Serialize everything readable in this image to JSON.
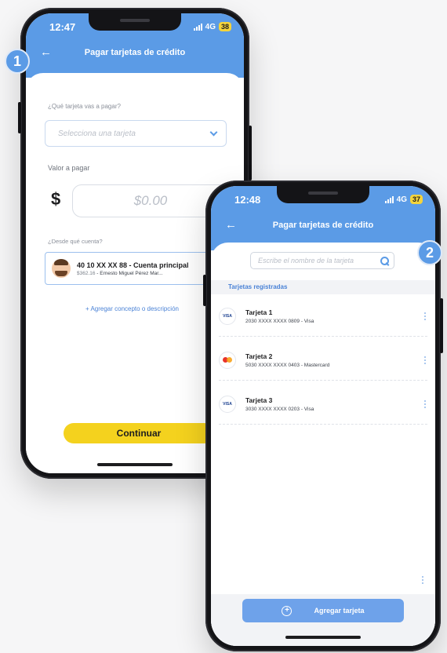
{
  "steps": {
    "step1": "1",
    "step2": "2"
  },
  "phone1": {
    "status": {
      "time": "12:47",
      "network": "4G",
      "battery": "38"
    },
    "header": {
      "title": "Pagar tarjetas de crédito"
    },
    "form": {
      "card_question": "¿Qué tarjeta vas a pagar?",
      "card_select_placeholder": "Selecciona una tarjeta",
      "amount_label": "Valor a pagar",
      "currency_symbol": "$",
      "amount_placeholder": "$0.00",
      "account_question": "¿Desde qué cuenta?",
      "account": {
        "title": "40 10 XX XX 88  - Cuenta principal",
        "balance": "$362.16",
        "holder": " - Ernesto Miguel Pérez Mar..."
      },
      "add_concept": "+ Agregar concepto o descripción",
      "continue_label": "Continuar"
    }
  },
  "phone2": {
    "status": {
      "time": "12:48",
      "network": "4G",
      "battery": "37"
    },
    "header": {
      "title": "Pagar tarjetas de crédito"
    },
    "search_placeholder": "Escribe el nombre de la tarjeta",
    "section_title": "Tarjetas registradas",
    "cards": [
      {
        "name": "Tarjeta 1",
        "number": "2030 XXXX XXXX 0809 - Visa",
        "brand": "visa",
        "logo_text": "VISA"
      },
      {
        "name": "Tarjeta 2",
        "number": "5030 XXXX XXXX 0403 - Mastercard",
        "brand": "mastercard",
        "logo_text": ""
      },
      {
        "name": "Tarjeta 3",
        "number": "3030 XXXX XXXX 0203 - Visa",
        "brand": "visa",
        "logo_text": "VISA"
      }
    ],
    "add_card_label": "Agregar tarjeta"
  },
  "colors": {
    "header_blue": "#5b9be6",
    "continue_yellow": "#f4d21e",
    "add_button_blue": "#6ea2ea",
    "battery_yellow": "#f4d43c"
  },
  "icons": [
    "back-arrow-icon",
    "signal-icon",
    "chevron-down-icon",
    "avatar",
    "search-icon",
    "visa-icon",
    "mastercard-icon",
    "kebab-menu-icon",
    "plus-circle-icon"
  ]
}
